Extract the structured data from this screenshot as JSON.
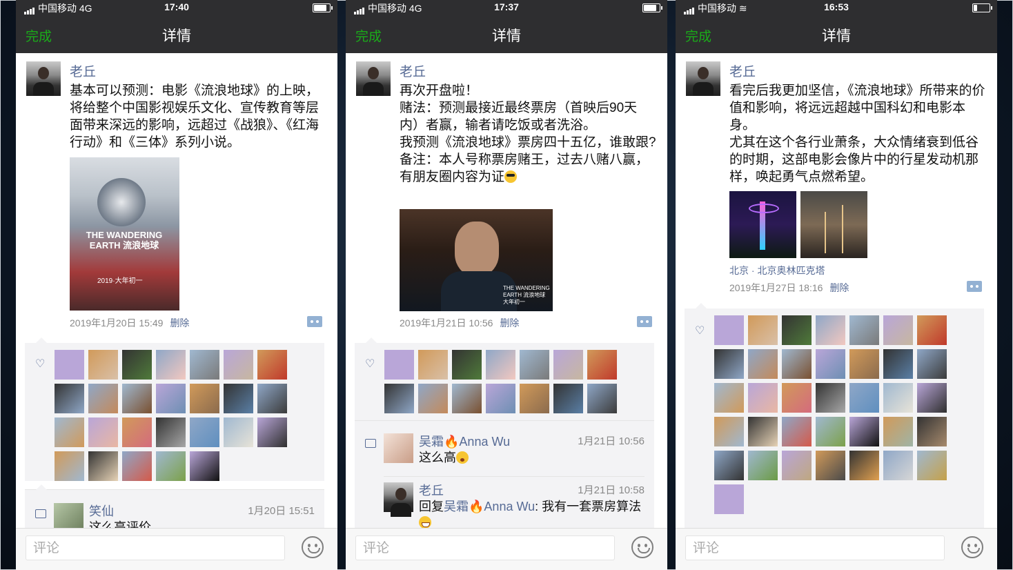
{
  "shared": {
    "nav_done": "完成",
    "nav_title": "详情",
    "comment_placeholder": "评论",
    "delete_label": "删除",
    "author": "老丘"
  },
  "phone1": {
    "carrier": "中国移动",
    "network": "4G",
    "time": "17:40",
    "text": "基本可以预测：电影《流浪地球》的上映，将给整个中国影视娱乐文化、宣传教育等层面带来深远的影响，远超过《战狼》、《红海行动》和《三体》系列小说。",
    "poster_text": "THE WANDERING EARTH 流浪地球",
    "poster_date": "2019·大年初一",
    "date": "2019年1月20日 15:49",
    "comment": {
      "name": "笑仙",
      "time": "1月20日 15:51",
      "text": "这么高评价"
    }
  },
  "phone2": {
    "carrier": "中国移动",
    "network": "4G",
    "time": "17:37",
    "text_lines": [
      "再次开盘啦！",
      "赌法：预测最接近最终票房（首映后90天内）者赢，输者请吃饭或者洗浴。",
      "我预测《流浪地球》票房四十五亿，谁敢跟?",
      "备注：本人号称票房赌王，过去八赌八赢，有朋友圈内容为证"
    ],
    "photo_text": "THE WANDERING EARTH 流浪地球 大年初一",
    "date": "2019年1月21日 10:56",
    "comments": [
      {
        "name_a": "吴霜",
        "name_b": "Anna Wu",
        "time": "1月21日 10:56",
        "text": "这么高"
      },
      {
        "name": "老丘",
        "time": "1月21日 10:58",
        "reply_prefix": "回复",
        "reply_a": "吴霜",
        "reply_b": "Anna Wu",
        "text": ": 我有一套票房算法"
      }
    ]
  },
  "phone3": {
    "carrier": "中国移动",
    "time": "16:53",
    "text_lines": [
      "看完后我更加坚信，《流浪地球》所带来的价值和影响，将远远超越中国科幻和电影本身。",
      "尤其在这个各行业萧条，大众情绪衰到低谷的时期，这部电影会像片中的行星发动机那样，唤起勇气点燃希望。"
    ],
    "location": "北京 · 北京奥林匹克塔",
    "date": "2019年1月27日 18:16"
  },
  "colors": {
    "accent_green": "#1aad19",
    "link_blue": "#576b95",
    "header_dark": "#2e2e30"
  }
}
